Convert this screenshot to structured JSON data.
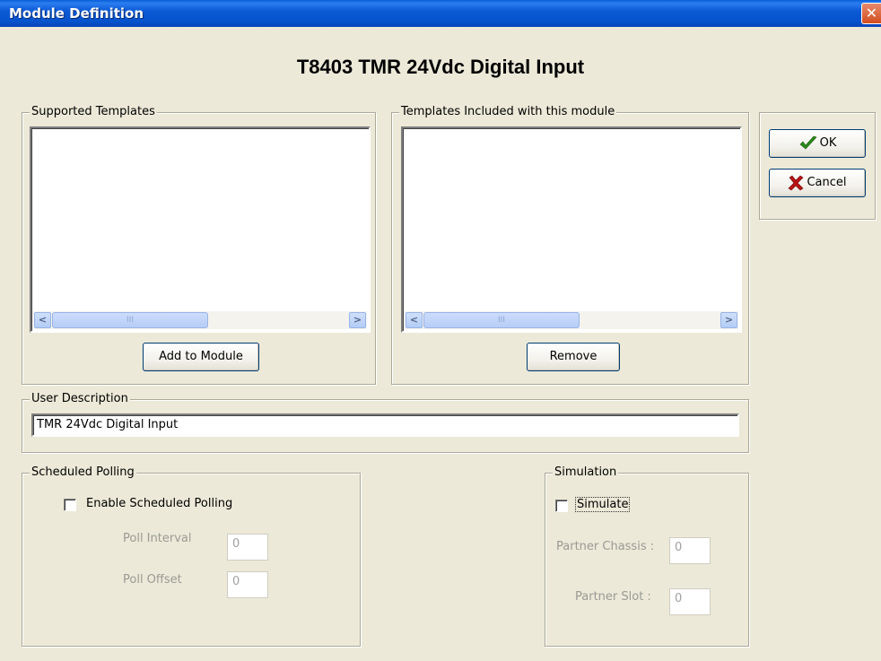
{
  "window": {
    "title": "Module Definition",
    "close": "✕"
  },
  "module_heading": "T8403 TMR 24Vdc Digital Input",
  "supported_templates": {
    "label": "Supported Templates",
    "items": [],
    "add_button": "Add to Module"
  },
  "included_templates": {
    "label": "Templates Included with this module",
    "items": [],
    "remove_button": "Remove"
  },
  "actions": {
    "ok": "OK",
    "cancel": "Cancel"
  },
  "user_description": {
    "label": "User Description",
    "value": "TMR 24Vdc Digital Input"
  },
  "scheduled_polling": {
    "label": "Scheduled Polling",
    "enable_label": "Enable Scheduled Polling",
    "enabled": false,
    "poll_interval_label": "Poll Interval",
    "poll_interval": "0",
    "poll_offset_label": "Poll Offset",
    "poll_offset": "0"
  },
  "simulation": {
    "label": "Simulation",
    "simulate_label": "Simulate",
    "simulate": false,
    "partner_chassis_label": "Partner Chassis :",
    "partner_chassis": "0",
    "partner_slot_label": "Partner Slot :",
    "partner_slot": "0"
  },
  "scrollbar": {
    "left_arrow": "<",
    "right_arrow": ">",
    "thumb_grip": "III"
  },
  "colors": {
    "titlebar": "#0653cc",
    "dialog": "#ece9d8",
    "ok_check": "#2a8a1a",
    "cancel_x": "#b81414"
  }
}
